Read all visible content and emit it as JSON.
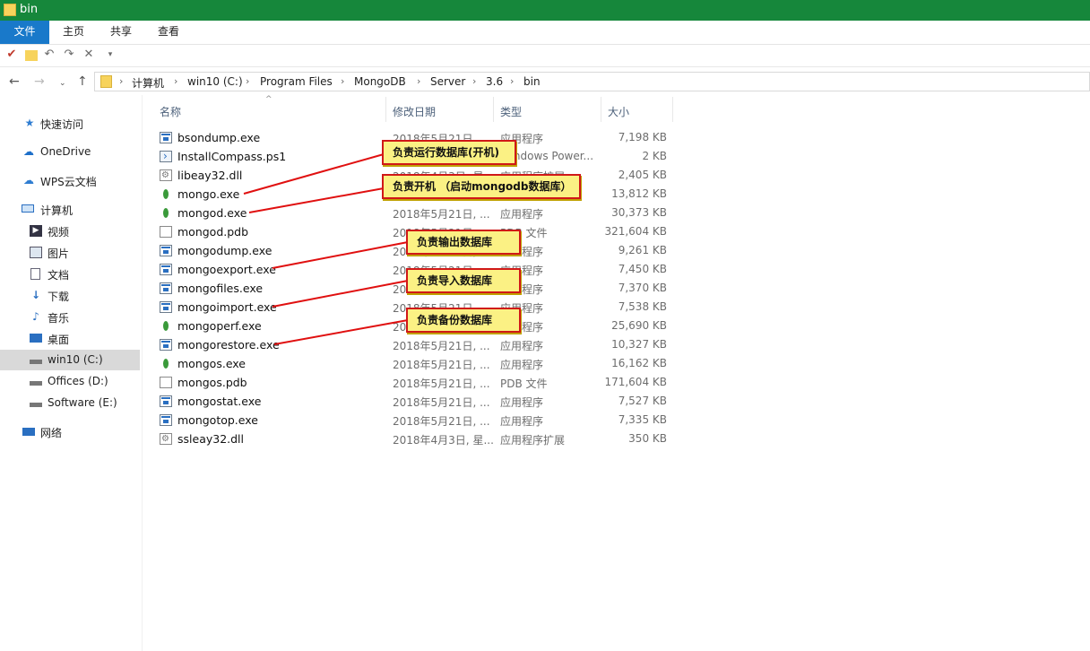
{
  "window": {
    "title": "bin"
  },
  "ribbon": {
    "tabs": [
      "文件",
      "主页",
      "共享",
      "查看"
    ]
  },
  "breadcrumb": [
    "计算机",
    "win10 (C:)",
    "Program Files",
    "MongoDB",
    "Server",
    "3.6",
    "bin"
  ],
  "sidebar": {
    "quick_access": "快速访问",
    "onedrive": "OneDrive",
    "wps": "WPS云文档",
    "computer": "计算机",
    "video": "视频",
    "pictures": "图片",
    "documents": "文档",
    "downloads": "下载",
    "music": "音乐",
    "desktop": "桌面",
    "drive_c": "win10 (C:)",
    "drive_d": "Offices (D:)",
    "drive_e": "Software (E:)",
    "network": "网络"
  },
  "columns": {
    "name": "名称",
    "date": "修改日期",
    "type": "类型",
    "size": "大小"
  },
  "files": [
    {
      "name": "bsondump.exe",
      "date": "2018年5月21日, ...",
      "type": "应用程序",
      "size": "7,198 KB",
      "icon": "exe-icon"
    },
    {
      "name": "InstallCompass.ps1",
      "date": "2018年5月21日, ...",
      "type": "Windows Power...",
      "size": "2 KB",
      "icon": "powershell-icon"
    },
    {
      "name": "libeay32.dll",
      "date": "2018年4月3日, 星...",
      "type": "应用程序扩展",
      "size": "2,405 KB",
      "icon": "dll-icon"
    },
    {
      "name": "mongo.exe",
      "date": "2018年5月21日, ...",
      "type": "应用程序",
      "size": "13,812 KB",
      "icon": "leaf-icon"
    },
    {
      "name": "mongod.exe",
      "date": "2018年5月21日, ...",
      "type": "应用程序",
      "size": "30,373 KB",
      "icon": "leaf-icon"
    },
    {
      "name": "mongod.pdb",
      "date": "2018年5月21日, ...",
      "type": "PDB 文件",
      "size": "321,604 KB",
      "icon": "document-icon"
    },
    {
      "name": "mongodump.exe",
      "date": "2018年5月21日, ...",
      "type": "应用程序",
      "size": "9,261 KB",
      "icon": "exe-icon"
    },
    {
      "name": "mongoexport.exe",
      "date": "2018年5月21日, ...",
      "type": "应用程序",
      "size": "7,450 KB",
      "icon": "exe-icon"
    },
    {
      "name": "mongofiles.exe",
      "date": "2018年5月21日, ...",
      "type": "应用程序",
      "size": "7,370 KB",
      "icon": "exe-icon"
    },
    {
      "name": "mongoimport.exe",
      "date": "2018年5月21日, ...",
      "type": "应用程序",
      "size": "7,538 KB",
      "icon": "exe-icon"
    },
    {
      "name": "mongoperf.exe",
      "date": "2018年5月21日, ...",
      "type": "应用程序",
      "size": "25,690 KB",
      "icon": "leaf-icon"
    },
    {
      "name": "mongorestore.exe",
      "date": "2018年5月21日, ...",
      "type": "应用程序",
      "size": "10,327 KB",
      "icon": "exe-icon"
    },
    {
      "name": "mongos.exe",
      "date": "2018年5月21日, ...",
      "type": "应用程序",
      "size": "16,162 KB",
      "icon": "leaf-icon"
    },
    {
      "name": "mongos.pdb",
      "date": "2018年5月21日, ...",
      "type": "PDB 文件",
      "size": "171,604 KB",
      "icon": "document-icon"
    },
    {
      "name": "mongostat.exe",
      "date": "2018年5月21日, ...",
      "type": "应用程序",
      "size": "7,527 KB",
      "icon": "exe-icon"
    },
    {
      "name": "mongotop.exe",
      "date": "2018年5月21日, ...",
      "type": "应用程序",
      "size": "7,335 KB",
      "icon": "exe-icon"
    },
    {
      "name": "ssleay32.dll",
      "date": "2018年4月3日, 星...",
      "type": "应用程序扩展",
      "size": "350 KB",
      "icon": "dll-icon"
    }
  ],
  "callouts": {
    "c1": "负责运行数据库(开机)",
    "c2": "负责开机 （启动mongodb数据库）",
    "c3": "负责输出数据库",
    "c4": "负责导入数据库",
    "c5": "负责备份数据库"
  },
  "colors": {
    "titlebar": "#16873b",
    "file_tab": "#1979ca",
    "callout_bg": "#fbf184",
    "callout_border": "#d01818"
  }
}
